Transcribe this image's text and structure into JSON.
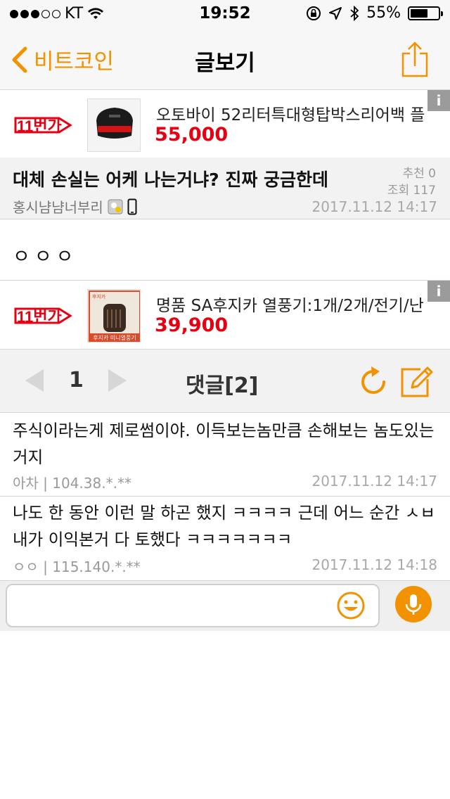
{
  "status_bar": {
    "carrier": "KT",
    "time": "19:52",
    "battery": "55%",
    "battery_level": 0.55
  },
  "nav": {
    "back_label": "비트코인",
    "title": "글보기"
  },
  "ads": [
    {
      "logo": "11번가",
      "name": "오토바이 52리터특대형탑박스리어백 플",
      "price": "55,000",
      "info": "i"
    },
    {
      "logo": "11번가",
      "name": "명품 SA후지카 열풍기:1개/2개/전기/난",
      "price": "39,900",
      "info": "i",
      "thumb_caption": "후지카 미니열풍기",
      "thumb_tag": "후지카"
    }
  ],
  "post": {
    "title": "대체 손실는 어케 나는거냐? 진짜 궁금한데",
    "recommend": "추천 0",
    "views": "조회 117",
    "author": "홍시냠냠너부리",
    "date": "2017.11.12 14:17",
    "body": "ㅇㅇㅇ"
  },
  "comment_bar": {
    "page": "1",
    "title": "댓글[2]"
  },
  "comments": [
    {
      "text": "주식이라는게 제로썸이야. 이득보는놈만큼 손해보는 놈도있는거지",
      "meta": "아차 | 104.38.*.**",
      "date": "2017.11.12 14:17"
    },
    {
      "text": "나도 한 동안 이런 말 하곤 했지 ㅋㅋㅋㅋ 근데 어느 순간 ㅅㅂ 내가 이익본거 다 토했다 ㅋㅋㅋㅋㅋㅋㅋ",
      "meta": "ㅇㅇ | 115.140.*.**",
      "date": "2017.11.12 14:18"
    }
  ],
  "input": {
    "placeholder": "",
    "value": ""
  },
  "colors": {
    "accent": "#f39200",
    "price": "#e60012",
    "logo": "#e60012"
  }
}
